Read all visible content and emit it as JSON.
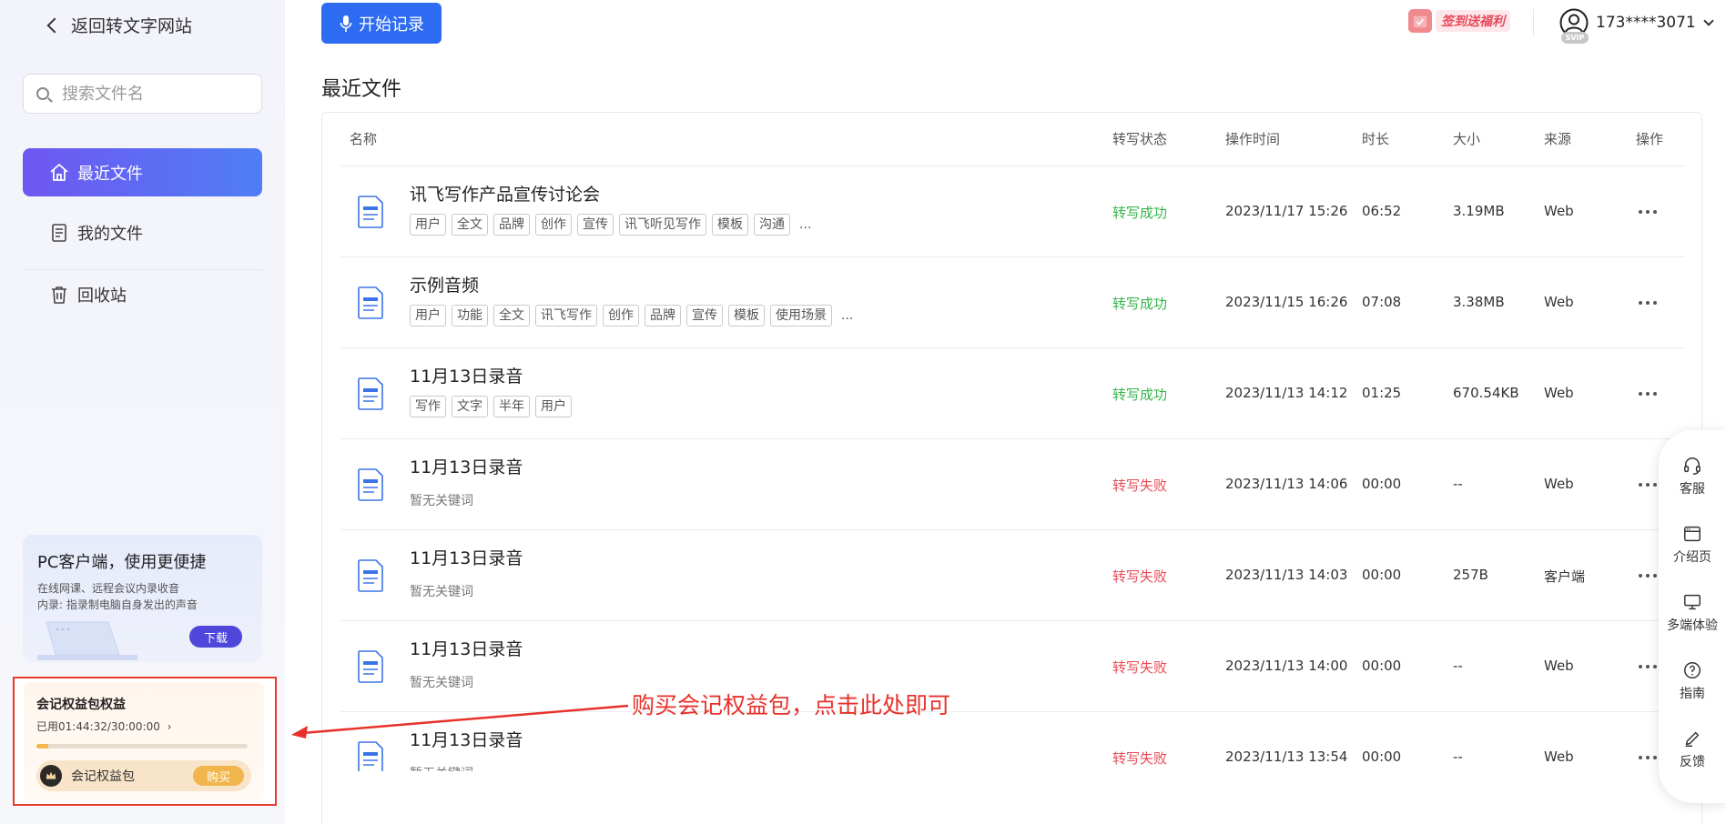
{
  "sidebar": {
    "back_label": "返回转文字网站",
    "search_placeholder": "搜索文件名",
    "nav": [
      {
        "label": "最近文件",
        "icon": "home-icon",
        "active": true
      },
      {
        "label": "我的文件",
        "icon": "document-icon",
        "active": false
      },
      {
        "label": "回收站",
        "icon": "trash-icon",
        "active": false
      }
    ],
    "pc_card": {
      "title": "PC客户端，使用更便捷",
      "line1": "在线网课、远程会议内录收音",
      "line2": "内录: 指录制电脑自身发出的声音",
      "download_label": "下载"
    },
    "benefit": {
      "title": "会记权益包权益",
      "usage": "已用01:44:32/30:00:00",
      "usage_arrow": "›",
      "progress_fraction": 0.058,
      "pill_label": "会记权益包",
      "buy_label": "购买"
    }
  },
  "header": {
    "start_label": "开始记录",
    "signin_label": "签到送福利",
    "user_name": "173****3071",
    "svip_label": "SVIP"
  },
  "page_title": "最近文件",
  "table": {
    "columns": [
      "名称",
      "转写状态",
      "操作时间",
      "时长",
      "大小",
      "来源",
      "操作"
    ],
    "no_keywords": "暂无关键词",
    "more": "...",
    "rows": [
      {
        "name": "讯飞写作产品宣传讨论会",
        "tags": [
          "用户",
          "全文",
          "品牌",
          "创作",
          "宣传",
          "讯飞听见写作",
          "模板",
          "沟通"
        ],
        "status": "转写成功",
        "ok": true,
        "time": "2023/11/17 15:26",
        "duration": "06:52",
        "size": "3.19MB",
        "source": "Web"
      },
      {
        "name": "示例音频",
        "tags": [
          "用户",
          "功能",
          "全文",
          "讯飞写作",
          "创作",
          "品牌",
          "宣传",
          "模板",
          "使用场景"
        ],
        "status": "转写成功",
        "ok": true,
        "time": "2023/11/15 16:26",
        "duration": "07:08",
        "size": "3.38MB",
        "source": "Web"
      },
      {
        "name": "11月13日录音",
        "tags": [
          "写作",
          "文字",
          "半年",
          "用户"
        ],
        "status": "转写成功",
        "ok": true,
        "time": "2023/11/13 14:12",
        "duration": "01:25",
        "size": "670.54KB",
        "source": "Web"
      },
      {
        "name": "11月13日录音",
        "tags": [],
        "status": "转写失败",
        "ok": false,
        "time": "2023/11/13 14:06",
        "duration": "00:00",
        "size": "--",
        "source": "Web"
      },
      {
        "name": "11月13日录音",
        "tags": [],
        "status": "转写失败",
        "ok": false,
        "time": "2023/11/13 14:03",
        "duration": "00:00",
        "size": "257B",
        "source": "客户端"
      },
      {
        "name": "11月13日录音",
        "tags": [],
        "status": "转写失败",
        "ok": false,
        "time": "2023/11/13 14:00",
        "duration": "00:00",
        "size": "--",
        "source": "Web"
      },
      {
        "name": "11月13日录音",
        "tags": [],
        "status": "转写失败",
        "ok": false,
        "time": "2023/11/13 13:54",
        "duration": "00:00",
        "size": "--",
        "source": "Web"
      }
    ]
  },
  "float_bar": [
    {
      "label": "客服",
      "icon": "headset-icon"
    },
    {
      "label": "介绍页",
      "icon": "browser-window-icon"
    },
    {
      "label": "多端体验",
      "icon": "monitor-icon"
    },
    {
      "label": "指南",
      "icon": "help-circle-icon"
    },
    {
      "label": "反馈",
      "icon": "pencil-icon"
    }
  ],
  "annotation": "购买会记权益包，点击此处即可",
  "colors": {
    "primary": "#2d6cf2",
    "nav_active_start": "#6f57f2",
    "nav_active_end": "#4f7ef5",
    "success": "#36b34a",
    "fail": "#e84a55",
    "annotation_red": "#e8312a",
    "buy_gold": "#f0b64d"
  }
}
